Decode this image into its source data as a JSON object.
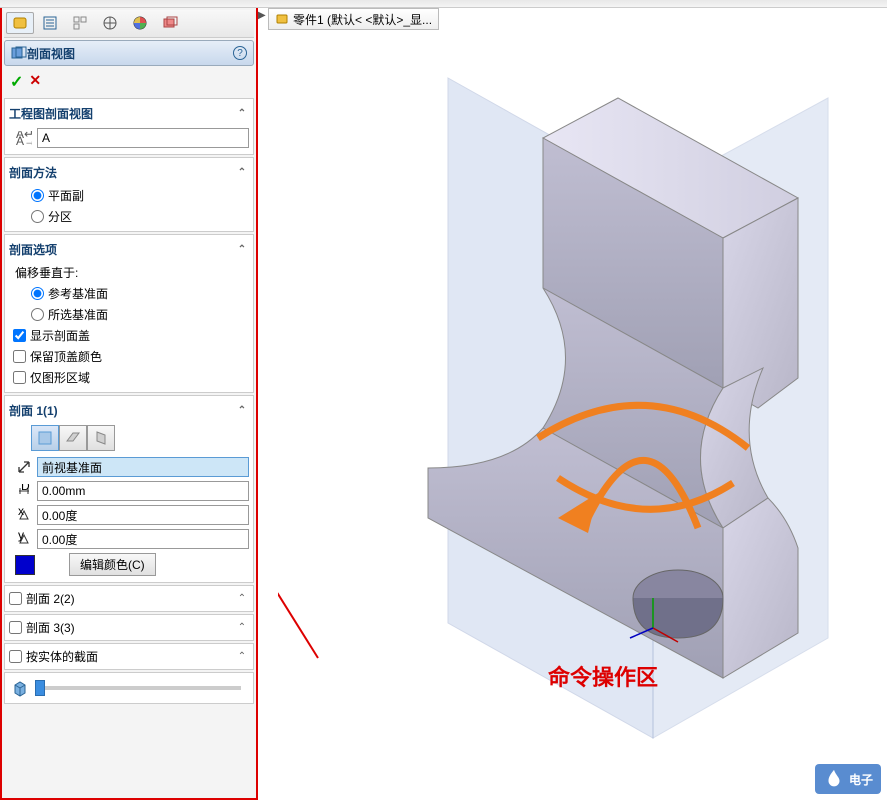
{
  "breadcrumb": {
    "part_label": "零件1  (默认< <默认>_显..."
  },
  "panel": {
    "title": "剖面视图",
    "sections": {
      "drawing": {
        "heading": "工程图剖面视图",
        "label_value": "A"
      },
      "method": {
        "heading": "剖面方法",
        "opt_plane": "平面副",
        "opt_zone": "分区"
      },
      "options": {
        "heading": "剖面选项",
        "offset_label": "偏移垂直于:",
        "opt_ref": "参考基准面",
        "opt_sel": "所选基准面",
        "chk_cap": "显示剖面盖",
        "chk_keep": "保留顶盖颜色",
        "chk_graphics": "仅图形区域"
      },
      "section1": {
        "heading": "剖面 1(1)",
        "plane_value": "前视基准面",
        "dist": "0.00mm",
        "ang1": "0.00度",
        "ang2": "0.00度",
        "edit_color": "编辑颜色(C)"
      },
      "section2": {
        "heading": "剖面 2(2)"
      },
      "section3": {
        "heading": "剖面 3(3)"
      },
      "by_body": {
        "heading": "按实体的截面"
      }
    }
  },
  "annotation": {
    "text": "命令操作区"
  },
  "watermark": {
    "text": "电子"
  }
}
